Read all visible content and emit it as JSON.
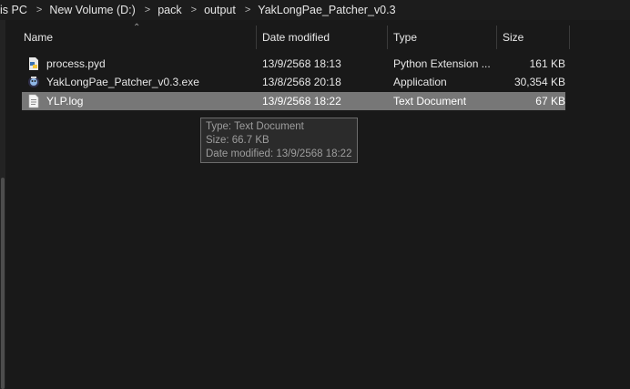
{
  "breadcrumb": [
    "is PC",
    "New Volume (D:)",
    "pack",
    "output",
    "YakLongPae_Patcher_v0.3"
  ],
  "columns": {
    "name": "Name",
    "date": "Date modified",
    "type": "Type",
    "size": "Size"
  },
  "files": [
    {
      "name": "process.pyd",
      "date": "13/9/2568 18:13",
      "type": "Python Extension ...",
      "size": "161 KB",
      "icon": "python-extension-icon"
    },
    {
      "name": "YakLongPae_Patcher_v0.3.exe",
      "date": "13/8/2568 20:18",
      "type": "Application",
      "size": "30,354 KB",
      "icon": "application-icon"
    },
    {
      "name": "YLP.log",
      "date": "13/9/2568 18:22",
      "type": "Text Document",
      "size": "67 KB",
      "icon": "text-document-icon",
      "selected": true
    }
  ],
  "tooltip": {
    "type": "Type: Text Document",
    "size": "Size: 66.7 KB",
    "date": "Date modified: 13/9/2568 18:22"
  },
  "colors": {
    "background": "#191919",
    "selection": "#777777",
    "tooltip_bg": "#2b2b2b"
  }
}
